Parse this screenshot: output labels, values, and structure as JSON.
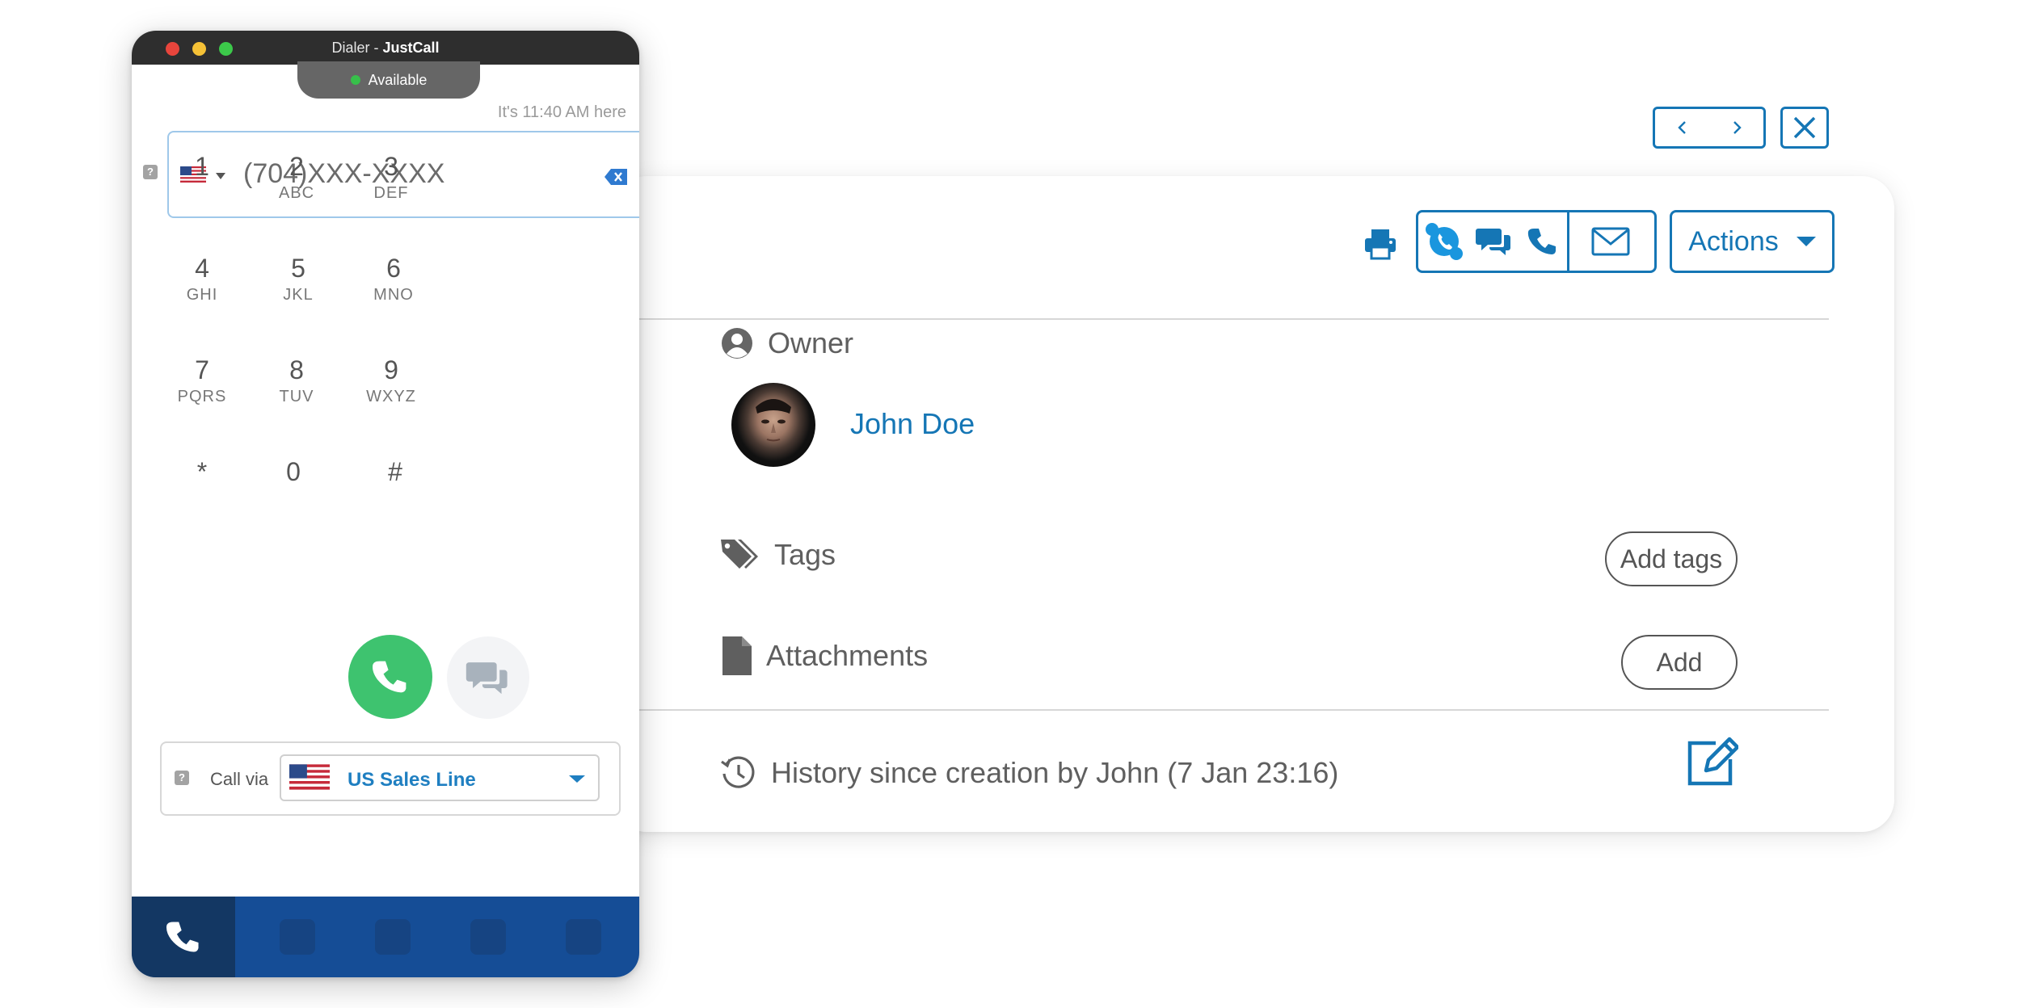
{
  "dialer": {
    "window_title_prefix": "Dialer - ",
    "window_title_app": "JustCall",
    "status": "Available",
    "local_time": "It's 11:40 AM here",
    "phone_placeholder": "(704)XXX-XXXX",
    "keypad": [
      {
        "digit": "1",
        "letters": ""
      },
      {
        "digit": "2",
        "letters": "ABC"
      },
      {
        "digit": "3",
        "letters": "DEF"
      },
      {
        "digit": "4",
        "letters": "GHI"
      },
      {
        "digit": "5",
        "letters": "JKL"
      },
      {
        "digit": "6",
        "letters": "MNO"
      },
      {
        "digit": "7",
        "letters": "PQRS"
      },
      {
        "digit": "8",
        "letters": "TUV"
      },
      {
        "digit": "9",
        "letters": "WXYZ"
      },
      {
        "digit": "*",
        "letters": ""
      },
      {
        "digit": "0",
        "letters": ""
      },
      {
        "digit": "#",
        "letters": ""
      }
    ],
    "call_via_label": "Call via",
    "selected_line": "US Sales Line",
    "help_glyph": "?"
  },
  "record": {
    "actions_label": "Actions",
    "owner_label": "Owner",
    "owner_name": "John Doe",
    "tags_label": "Tags",
    "add_tags_label": "Add tags",
    "attachments_label": "Attachments",
    "add_label": "Add",
    "history_label": "History since creation by John (7 Jan 23:16)"
  },
  "icons": {
    "nav_prev": "chevron-left-icon",
    "nav_next": "chevron-right-icon",
    "close": "close-icon",
    "print": "printer-icon",
    "skype": "skype-icon",
    "chat": "chat-icon",
    "phone": "phone-icon",
    "email": "envelope-icon",
    "owner": "user-circle-icon",
    "tags": "tag-icon",
    "attachments": "file-icon",
    "history": "history-icon",
    "edit": "edit-icon"
  },
  "colors": {
    "accent_blue": "#1576b5",
    "call_green": "#3ec36f",
    "nav_blue": "#154d96",
    "nav_active": "#133763",
    "status_green": "#37c04a"
  }
}
